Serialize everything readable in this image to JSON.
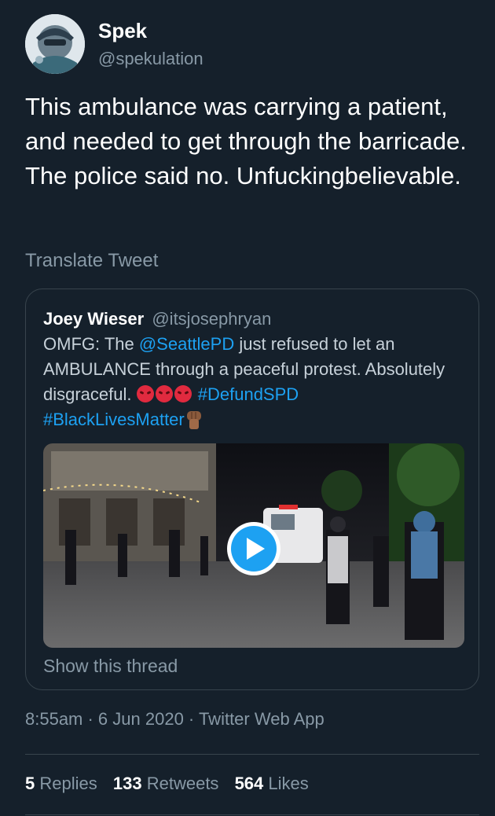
{
  "tweet": {
    "author_name": "Spek",
    "author_handle": "@spekulation",
    "text": "This ambulance was carrying a patient, and needed to get through the barricade. The police said no. Unfuckingbelievable.",
    "translate_label": "Translate Tweet",
    "timestamp": "8:55am · 6 Jun 2020 · Twitter Web App"
  },
  "quote": {
    "author_name": "Joey Wieser",
    "author_handle": "@itsjosephryan",
    "text_part1": "OMFG: The ",
    "mention": "@SeattlePD",
    "text_part2": " just refused to let an AMBULANCE through a peaceful protest. Absolutely disgraceful. ",
    "hashtag1": "#DefundSPD",
    "hashtag2": "#BlackLivesMatter",
    "show_thread_label": "Show this thread"
  },
  "stats": {
    "replies_count": "5",
    "replies_label": "Replies",
    "retweets_count": "133",
    "retweets_label": "Retweets",
    "likes_count": "564",
    "likes_label": "Likes"
  },
  "colors": {
    "background": "#15202b",
    "link": "#1da1f2",
    "secondary_text": "#8899a6"
  }
}
